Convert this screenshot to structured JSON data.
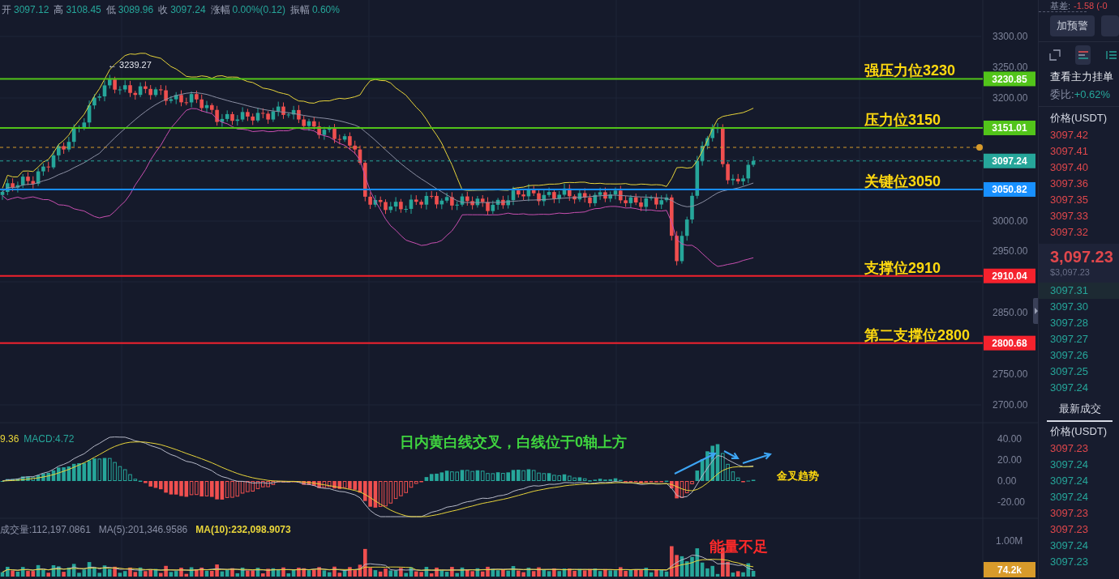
{
  "ohlc_header": [
    {
      "label": "开",
      "value": "3097.12"
    },
    {
      "label": "高",
      "value": "3108.45"
    },
    {
      "label": "低",
      "value": "3089.96"
    },
    {
      "label": "收",
      "value": "3097.24"
    },
    {
      "label": "涨幅",
      "value": "0.00%(0.12)"
    },
    {
      "label": "振幅",
      "value": "0.60%"
    }
  ],
  "high_marker": "← 3239.27",
  "price_axis": [
    "3300.00",
    "3250.00",
    "3200.00",
    "3000.00",
    "2950.00",
    "2850.00",
    "2750.00",
    "2700.00"
  ],
  "levels": [
    {
      "label": "强压力位3230",
      "tag": "3230.85",
      "color": "#52c41a"
    },
    {
      "label": "压力位3150",
      "tag": "3151.01",
      "color": "#52c41a"
    },
    {
      "label": "关键位3050",
      "tag": "3050.82",
      "color": "#1890ff"
    },
    {
      "label": "支撑位2910",
      "tag": "2910.04",
      "color": "#f5222d"
    },
    {
      "label": "第二支撑位2800",
      "tag": "2800.68",
      "color": "#f5222d"
    }
  ],
  "last_price_tag": "3097.24",
  "macd": {
    "legend": [
      {
        "text": "9.36",
        "color": "#e8d53a"
      },
      {
        "text": "MACD:4.72",
        "color": "#26a69a"
      }
    ],
    "annotation": "日内黄白线交叉，白线位于0轴上方",
    "signal_note": "金叉趋势",
    "ticks": [
      "40.00",
      "20.00",
      "0.00",
      "-20.00"
    ]
  },
  "volume": {
    "legend": [
      {
        "text": "成交量:112,197.0861",
        "color": "#8a90a6"
      },
      {
        "text": "MA(5):201,346.9586",
        "color": "#8a90a6"
      },
      {
        "text": "MA(10):232,098.9073",
        "color": "#e8d53a"
      }
    ],
    "tick": "1.00M",
    "last_tag": "74.2k",
    "note": "能量不足"
  },
  "side_panel": {
    "basis_label": "基差:",
    "basis_value": "-1.58 (-0",
    "alert_button": "加预警",
    "view_tabs": [
      {
        "selected": false
      },
      {
        "selected": true
      },
      {
        "selected": false
      }
    ],
    "orderbook_link": "查看主力挂单",
    "ratio_label": "委比:",
    "ratio_value": "+0.62%",
    "price_header": "价格(USDT)",
    "asks": [
      "3097.42",
      "3097.41",
      "3097.40",
      "3097.36",
      "3097.35",
      "3097.33",
      "3097.32"
    ],
    "mid_price": "3,097.23",
    "mid_usd": "$3,097.23",
    "bids": [
      "3097.31",
      "3097.30",
      "3097.28",
      "3097.27",
      "3097.26",
      "3097.25",
      "3097.24"
    ],
    "trades_tab": {
      "label": "最新成交",
      "selected": true
    },
    "trades_header": "价格(USDT)",
    "trades": [
      {
        "price": "3097.23",
        "kind": "sell"
      },
      {
        "price": "3097.24",
        "kind": "buy"
      },
      {
        "price": "3097.24",
        "kind": "buy"
      },
      {
        "price": "3097.24",
        "kind": "buy"
      },
      {
        "price": "3097.23",
        "kind": "sell"
      },
      {
        "price": "3097.23",
        "kind": "sell"
      },
      {
        "price": "3097.24",
        "kind": "buy"
      },
      {
        "price": "3097.23",
        "kind": "buy"
      }
    ]
  }
}
